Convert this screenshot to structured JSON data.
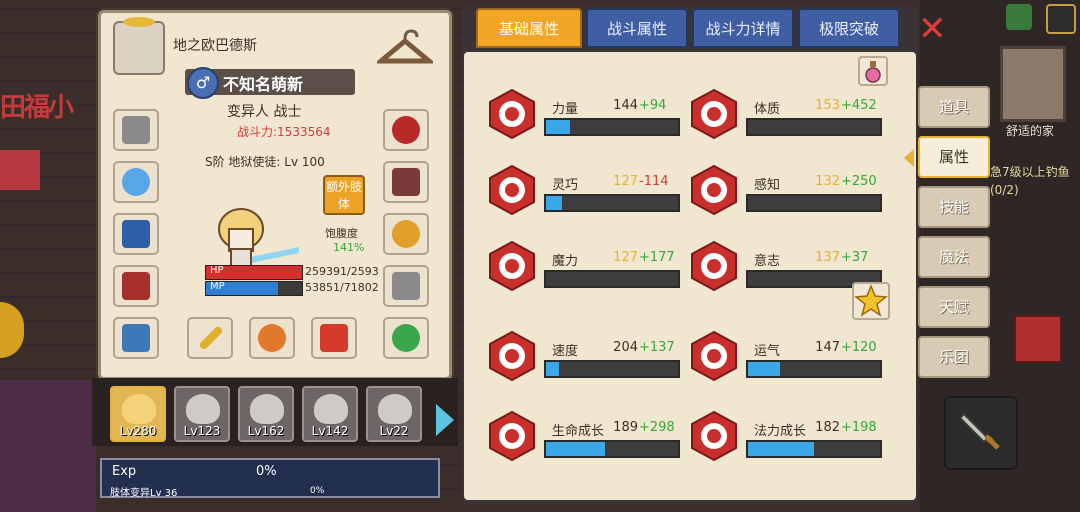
{
  "background": {
    "sign_text": "田福小",
    "home_label": "舒适的家",
    "quest_text": "急7级以上钓鱼(0/2)"
  },
  "character": {
    "title": "地之欧巴德斯",
    "name": "不知名萌新",
    "class": "变异人 战士",
    "power": "战斗力:1533564",
    "rank": "S阶 地狱使徒: Lv 100",
    "extra_button": "额外肢体",
    "satiety_label": "饱腹度",
    "satiety_value": "141%",
    "hp_label": "HP",
    "hp_value": "259391/2593",
    "hp_fraction": 1.0,
    "mp_label": "MP",
    "mp_value": "53851/71802",
    "mp_fraction": 0.75
  },
  "team": {
    "members": [
      {
        "level": "Lv280"
      },
      {
        "level": "Lv123"
      },
      {
        "level": "Lv162"
      },
      {
        "level": "Lv142"
      },
      {
        "level": "Lv22"
      }
    ]
  },
  "exp": {
    "label": "Exp",
    "percent": "0%",
    "mutation_label": "肢体变异Lv 36",
    "mutation_percent": "0%"
  },
  "tabs": [
    "基础属性",
    "战斗属性",
    "战斗力详情",
    "极限突破"
  ],
  "stats": [
    {
      "name": "力量",
      "base": "144",
      "bonus": "+94",
      "bonus_color": "#38a73a",
      "fill": 0.18
    },
    {
      "name": "体质",
      "base": "153",
      "bonus": "+452",
      "bonus_color": "#38a73a",
      "base_color": "#e6b02a",
      "fill": 0.0
    },
    {
      "name": "灵巧",
      "base": "127",
      "bonus": "-114",
      "bonus_color": "#d23b3b",
      "base_color": "#e6b02a",
      "fill": 0.12
    },
    {
      "name": "感知",
      "base": "132",
      "bonus": "+250",
      "bonus_color": "#38a73a",
      "base_color": "#e6b02a",
      "fill": 0.0
    },
    {
      "name": "魔力",
      "base": "127",
      "bonus": "+177",
      "bonus_color": "#38a73a",
      "base_color": "#e6b02a",
      "fill": 0.0
    },
    {
      "name": "意志",
      "base": "137",
      "bonus": "+37",
      "bonus_color": "#38a73a",
      "base_color": "#e6b02a",
      "fill": 0.0
    },
    {
      "name": "速度",
      "base": "204",
      "bonus": "+137",
      "bonus_color": "#38a73a",
      "fill": 0.1
    },
    {
      "name": "运气",
      "base": "147",
      "bonus": "+120",
      "bonus_color": "#38a73a",
      "fill": 0.24
    },
    {
      "name": "生命成长",
      "base": "189",
      "bonus": "+298",
      "bonus_color": "#38a73a",
      "fill": 0.45
    },
    {
      "name": "法力成长",
      "base": "182",
      "bonus": "+198",
      "bonus_color": "#38a73a",
      "fill": 0.5
    }
  ],
  "side_menu": [
    "道具",
    "属性",
    "技能",
    "魔法",
    "天赋",
    "乐团"
  ],
  "colors": {
    "accent_gold": "#f2a626",
    "tab_blue": "#3f5ea4",
    "stat_bar_blue": "#3aa7e8",
    "hp_red": "#d42f2f",
    "mp_blue": "#2f7fd4"
  }
}
